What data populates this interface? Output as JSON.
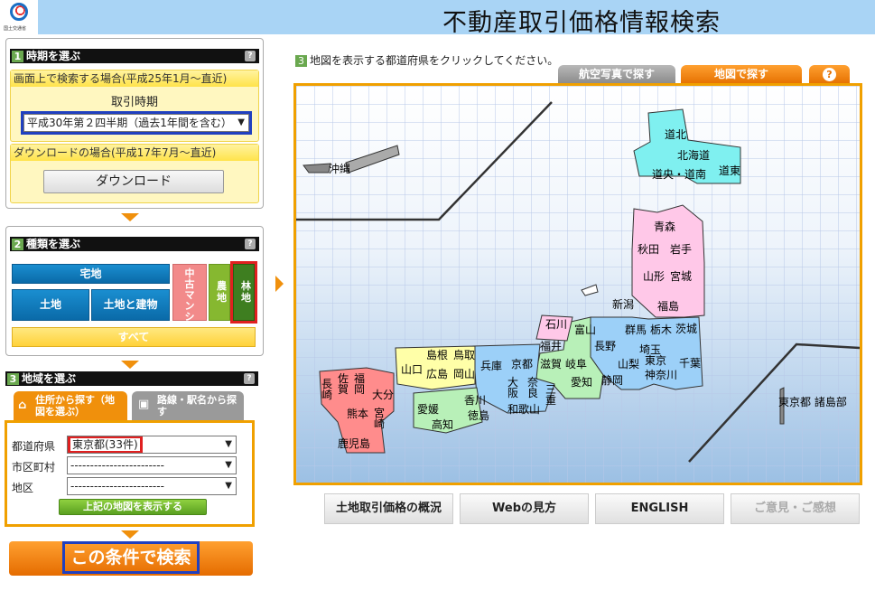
{
  "header": {
    "title": "不動産取引価格情報検索",
    "logo_text": "国土交通省"
  },
  "section1": {
    "num": "1",
    "title": "時期を選ぶ",
    "screen_search_label": "画面上で検索する場合(平成25年1月〜直近)",
    "period_label": "取引時期",
    "period_value": "平成30年第２四半期（過去1年間を含む）",
    "download_label": "ダウンロードの場合(平成17年7月〜直近)",
    "download_button": "ダウンロード"
  },
  "section2": {
    "num": "2",
    "title": "種類を選ぶ",
    "types": {
      "residential": "宅地",
      "land": "土地",
      "land_building": "土地と建物",
      "used_mansion": "中古マンション等",
      "farmland": "農地",
      "forest": "林地",
      "all": "すべて"
    }
  },
  "section3": {
    "num": "3",
    "title": "地域を選ぶ",
    "tab_address": "住所から探す（地図を選ぶ）",
    "tab_route": "路線・駅名から探す",
    "prefecture_label": "都道府県",
    "prefecture_value": "東京都(33件)",
    "city_label": "市区町村",
    "city_value": "------------------------",
    "district_label": "地区",
    "district_value": "------------------------",
    "show_map_button": "上記の地図を表示する"
  },
  "search_button": "この条件で検索",
  "map": {
    "num": "3",
    "instruction": "地図を表示する都道府県をクリックしてください。",
    "tabs": {
      "aerial": "航空写真で探す",
      "map": "地図で探す",
      "help": "?"
    }
  },
  "prefectures": [
    "道北",
    "北海道",
    "道央・道南",
    "道東",
    "沖縄",
    "青森",
    "秋田",
    "岩手",
    "山形",
    "宮城",
    "新潟",
    "福島",
    "石川",
    "富山",
    "群馬",
    "栃木",
    "茨城",
    "長野",
    "埼玉",
    "福井",
    "山梨",
    "東京",
    "千葉",
    "神奈川",
    "滋賀",
    "岐阜",
    "島根",
    "鳥取",
    "山口",
    "広島",
    "岡山",
    "兵庫",
    "京都",
    "大阪",
    "奈良",
    "和歌山",
    "三重",
    "愛知",
    "静岡",
    "佐賀",
    "福岡",
    "長崎",
    "大分",
    "熊本",
    "宮崎",
    "鹿児島",
    "愛媛",
    "香川",
    "徳島",
    "高知",
    "東京都 諸島部"
  ],
  "bottom_buttons": {
    "overview": "土地取引価格の概況",
    "web_guide": "Webの見方",
    "english": "ENGLISH",
    "feedback": "ご意見・ご感想"
  },
  "colors": {
    "hokkaido": "#7ff0f0",
    "tohoku": "#ffc8e8",
    "kanto": "#9cd0f8",
    "chubu": "#b8f0b8",
    "kinki": "#9cd0f8",
    "chugoku": "#ffffa8",
    "shikoku": "#b8f0b8",
    "kyushu": "#ff8c8c",
    "accent": "#f0900c",
    "highlight_red": "#e02020",
    "highlight_blue": "#2040c0"
  }
}
